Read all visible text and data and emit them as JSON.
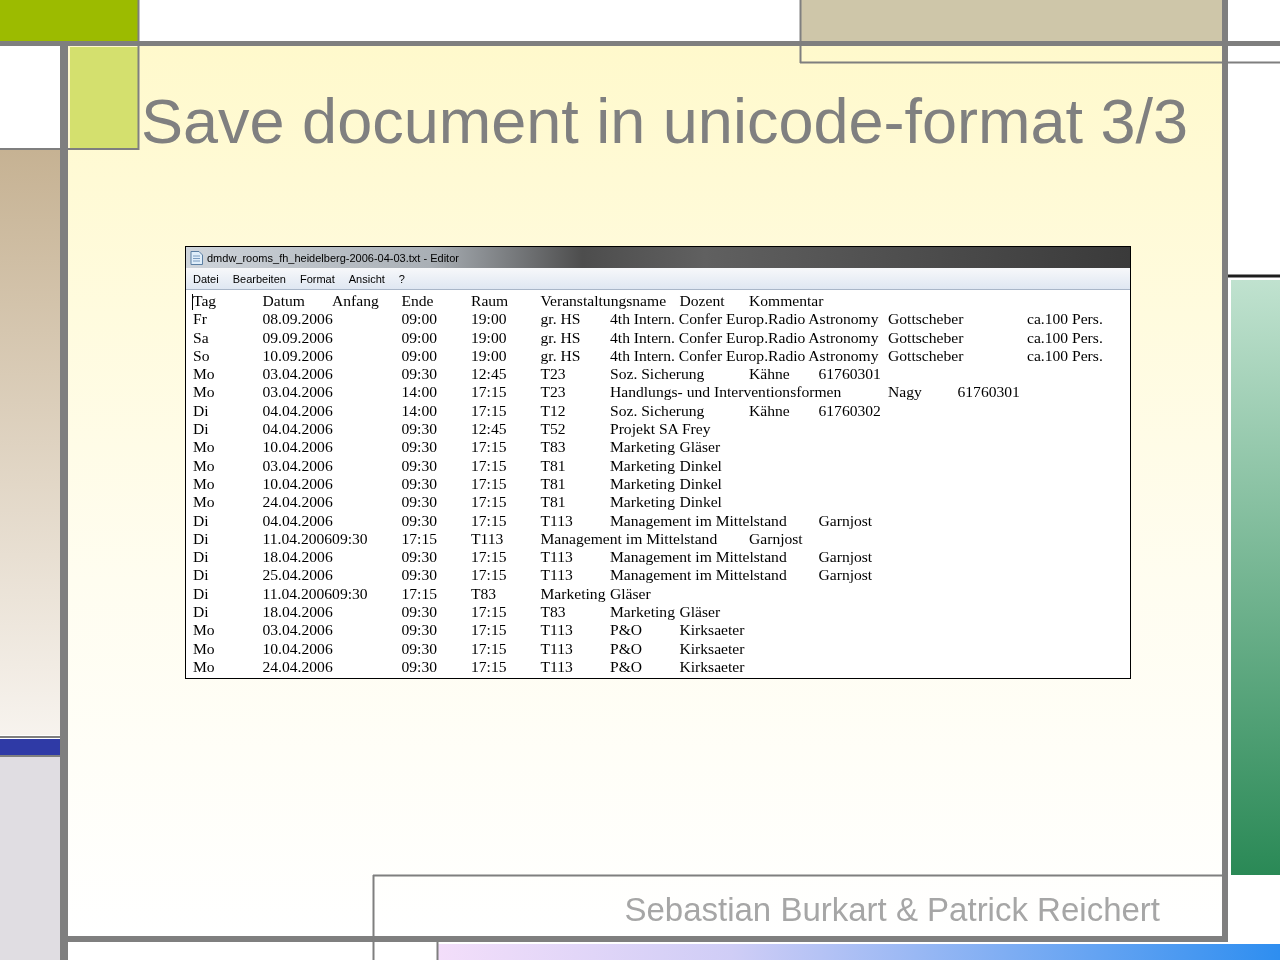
{
  "title": "Save document in unicode-format 3/3",
  "editor": {
    "title": "dmdw_rooms_fh_heidelberg-2006-04-03.txt - Editor",
    "menu": [
      "Datei",
      "Bearbeiten",
      "Format",
      "Ansicht",
      "?"
    ],
    "lines": [
      [
        "Tag",
        "Datum",
        "Anfang",
        "Ende",
        "Raum",
        "Veranstaltungsname",
        "Dozent",
        "Kommentar"
      ],
      [
        "Fr",
        "08.09.2006",
        "09:00",
        "19:00",
        "gr. HS",
        "4th Intern. Confer Europ.Radio Astronomy",
        "Gottscheber",
        "ca.100 Pers."
      ],
      [
        "Sa",
        "09.09.2006",
        "09:00",
        "19:00",
        "gr. HS",
        "4th Intern. Confer Europ.Radio Astronomy",
        "Gottscheber",
        "ca.100 Pers."
      ],
      [
        "So",
        "10.09.2006",
        "09:00",
        "19:00",
        "gr. HS",
        "4th Intern. Confer Europ.Radio Astronomy",
        "Gottscheber",
        "ca.100 Pers."
      ],
      [
        "Mo",
        "03.04.2006",
        "09:30",
        "12:45",
        "T23",
        "Soz. Sicherung",
        "Kähne",
        "61760301"
      ],
      [
        "Mo",
        "03.04.2006",
        "14:00",
        "17:15",
        "T23",
        "Handlungs- und Interventionsformen",
        "Nagy",
        "61760301"
      ],
      [
        "Di",
        "04.04.2006",
        "14:00",
        "17:15",
        "T12",
        "Soz. Sicherung",
        "Kähne",
        "61760302"
      ],
      [
        "Di",
        "04.04.2006",
        "09:30",
        "12:45",
        "T52",
        "Projekt SA Frey"
      ],
      [
        "Mo",
        "10.04.2006",
        "09:30",
        "17:15",
        "T83",
        "Marketing",
        "Gläser"
      ],
      [
        "Mo",
        "03.04.2006",
        "09:30",
        "17:15",
        "T81",
        "Marketing",
        "Dinkel"
      ],
      [
        "Mo",
        "10.04.2006",
        "09:30",
        "17:15",
        "T81",
        "Marketing",
        "Dinkel"
      ],
      [
        "Mo",
        "24.04.2006",
        "09:30",
        "17:15",
        "T81",
        "Marketing",
        "Dinkel"
      ],
      [
        "Di",
        "04.04.2006",
        "09:30",
        "17:15",
        "T113",
        "Management im Mittelstand",
        "Garnjost"
      ],
      [
        "Di",
        "11.04.200609:30",
        "17:15",
        "T113",
        "Management im Mittelstand",
        "Garnjost"
      ],
      [
        "Di",
        "18.04.2006",
        "09:30",
        "17:15",
        "T113",
        "Management im Mittelstand",
        "Garnjost"
      ],
      [
        "Di",
        "25.04.2006",
        "09:30",
        "17:15",
        "T113",
        "Management im Mittelstand",
        "Garnjost"
      ],
      [
        "Di",
        "11.04.200609:30",
        "17:15",
        "T83",
        "Marketing",
        "Gläser"
      ],
      [
        "Di",
        "18.04.2006",
        "09:30",
        "17:15",
        "T83",
        "Marketing",
        "Gläser"
      ],
      [
        "Mo",
        "03.04.2006",
        "09:30",
        "17:15",
        "T113",
        "P&O",
        "Kirksaeter"
      ],
      [
        "Mo",
        "10.04.2006",
        "09:30",
        "17:15",
        "T113",
        "P&O",
        "Kirksaeter"
      ],
      [
        "Mo",
        "24.04.2006",
        "09:30",
        "17:15",
        "T113",
        "P&O",
        "Kirksaeter"
      ]
    ]
  },
  "footer": "Sebastian Burkart & Patrick Reichert"
}
